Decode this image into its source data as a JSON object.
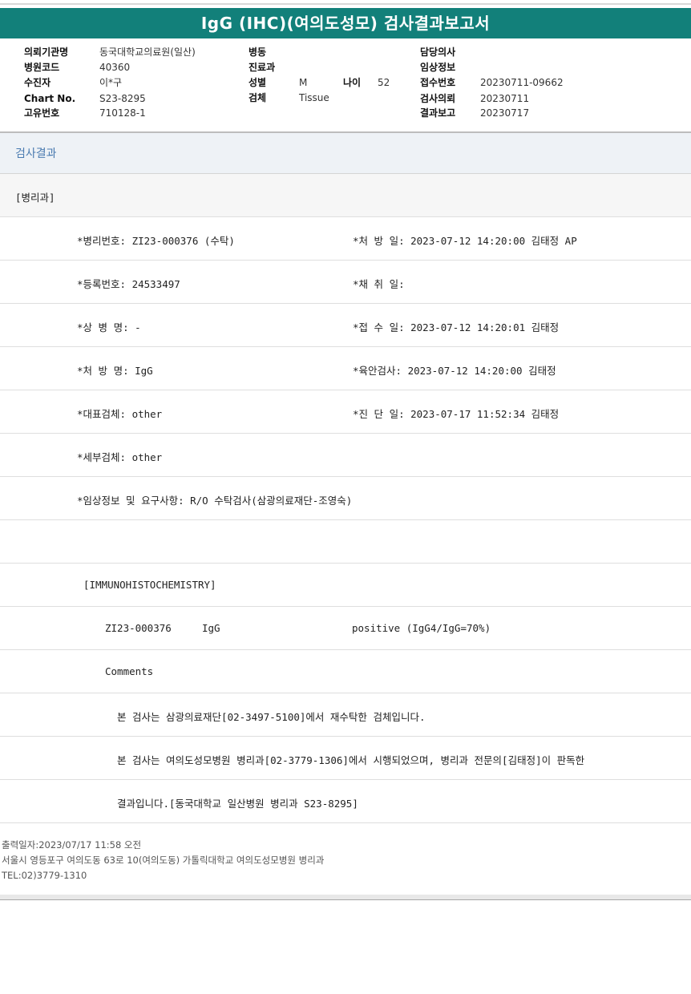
{
  "title": "IgG (IHC)(여의도성모) 검사결과보고서",
  "header": {
    "col1": [
      {
        "label": "의뢰기관명",
        "value": "동국대학교의료원(일산)"
      },
      {
        "label": "병원코드",
        "value": "40360"
      },
      {
        "label": "수진자",
        "value": "이*구"
      },
      {
        "label": "Chart No.",
        "value": "S23-8295"
      },
      {
        "label": "고유번호",
        "value": "710128-1"
      }
    ],
    "col2": {
      "ward_label": "병동",
      "ward_value": "",
      "dept_label": "진료과",
      "dept_value": "",
      "sex_label": "성별",
      "sex_value": "M",
      "age_label": "나이",
      "age_value": "52",
      "specimen_label": "검체",
      "specimen_value": "Tissue"
    },
    "col3": [
      {
        "label": "담당의사",
        "value": ""
      },
      {
        "label": "임상정보",
        "value": ""
      },
      {
        "label": "접수번호",
        "value": "20230711-09662"
      },
      {
        "label": "검사의뢰",
        "value": "20230711"
      },
      {
        "label": "결과보고",
        "value": "20230717"
      }
    ]
  },
  "results": {
    "section_title": "검사결과",
    "department": "[병리과]",
    "lines": [
      {
        "left": "*병리번호: ZI23-000376 (수탁)",
        "right": "*처 방 일: 2023-07-12 14:20:00  김태정 AP"
      },
      {
        "left": "*등록번호: 24533497",
        "right": "*채 취 일:"
      },
      {
        "left": "*상 병 명: -",
        "right": "*접 수 일: 2023-07-12 14:20:01  김태정"
      },
      {
        "left": "*처 방 명: IgG",
        "right": "*육안검사: 2023-07-12 14:20:00  김태정"
      },
      {
        "left": "*대표검체: other",
        "right": "*진 단 일: 2023-07-17 11:52:34  김태정"
      },
      {
        "left": "*세부검체: other",
        "right": ""
      },
      {
        "left": "*임상정보 및 요구사항: R/O 수탁검사(삼광의료재단-조영숙)",
        "right": ""
      }
    ],
    "ihc_heading": "[IMMUNOHISTOCHEMISTRY]",
    "ihc_row": {
      "id": "ZI23-000376",
      "stain": "IgG",
      "result": "positive (IgG4/IgG=70%)"
    },
    "comments_label": "Comments",
    "comments": [
      "본 검사는 삼광의료재단[02-3497-5100]에서 재수탁한 검체입니다.",
      "본 검사는 여의도성모병원 병리과[02-3779-1306]에서 시행되었으며, 병리과 전문의[김태정]이 판독한",
      "결과입니다.[동국대학교 일산병원 병리과 S23-8295]"
    ]
  },
  "footer": {
    "print_date": "출력일자:2023/07/17 11:58 오전",
    "address": "서울시 영등포구 여의도동 63로 10(여의도동) 가톨릭대학교 여의도성모병원 병리과",
    "tel": "TEL:02)3779-1310"
  },
  "colors": {
    "title_bar": "#12807a",
    "section_title": "#4a7bb0"
  }
}
